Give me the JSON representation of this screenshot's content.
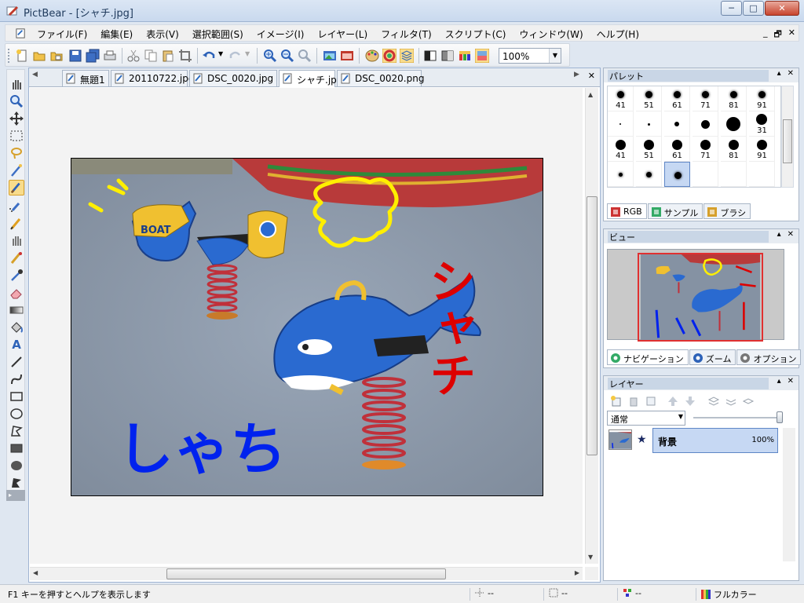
{
  "window": {
    "title": "PictBear - [シャチ.jpg]",
    "minimize": "─",
    "maximize": "□",
    "close": "✕"
  },
  "menu": {
    "items": [
      "ファイル(F)",
      "編集(E)",
      "表示(V)",
      "選択範囲(S)",
      "イメージ(I)",
      "レイヤー(L)",
      "フィルタ(T)",
      "スクリプト(C)",
      "ウィンドウ(W)",
      "ヘルプ(H)"
    ],
    "mdi_min": "_",
    "mdi_restore": "🗗",
    "mdi_close": "✕"
  },
  "toolbar": {
    "zoom_value": "100%"
  },
  "documents": {
    "tabs": [
      {
        "label": "無題1",
        "active": false
      },
      {
        "label": "20110722.jpg",
        "active": false
      },
      {
        "label": "DSC_0020.jpg",
        "active": false
      },
      {
        "label": "シャチ.jpg",
        "active": true
      },
      {
        "label": "DSC_0020.png",
        "active": false
      }
    ],
    "close_label": "✕"
  },
  "image_annotations": {
    "boat_text": "BOAT",
    "red_text": "シャチ",
    "blue_text": "しゃち"
  },
  "palette_panel": {
    "title": "パレット",
    "brush_rows": [
      [
        "41",
        "51",
        "61",
        "71",
        "81",
        "91"
      ],
      [
        "",
        "",
        "",
        "",
        "",
        "31"
      ],
      [
        "41",
        "51",
        "61",
        "71",
        "81",
        "91"
      ],
      [
        "",
        "",
        "",
        "",
        "",
        ""
      ]
    ],
    "tabs": [
      "RGB",
      "サンプル",
      "ブラシ"
    ]
  },
  "view_panel": {
    "title": "ビュー",
    "tabs": [
      "ナビゲーション",
      "ズーム",
      "オプション"
    ]
  },
  "layer_panel": {
    "title": "レイヤー",
    "blend_mode": "通常",
    "opacity_value": 1.0,
    "layers": [
      {
        "name": "背景",
        "opacity": "100%"
      }
    ]
  },
  "status": {
    "help_text": "F1 キーを押すとヘルプを表示します",
    "cursor_pos": "--",
    "selection_size": "--",
    "color_value": "--",
    "color_mode": "フルカラー"
  }
}
